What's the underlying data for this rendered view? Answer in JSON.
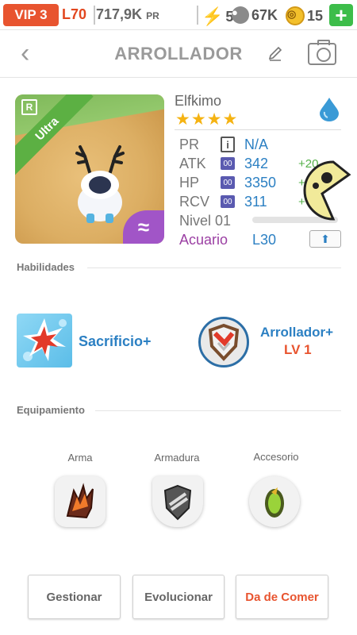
{
  "status_bar": {
    "vip": "VIP 3",
    "level": "L70",
    "power_value": "717,9K",
    "power_unit": "PR",
    "energy": "5",
    "food": "67K",
    "coins": "15",
    "add_label": "+"
  },
  "header": {
    "back_glyph": "‹",
    "title": "ARROLLADOR"
  },
  "monster": {
    "name": "Elfkimo",
    "stars": "★★★★",
    "rarity_letter": "R",
    "rarity_ribbon": "Ultra",
    "element_glyph": "≈",
    "stats": [
      {
        "label": "PR",
        "icon": "i",
        "value": "N/A",
        "bonus": ""
      },
      {
        "label": "ATK",
        "icon": "00",
        "value": "342",
        "bonus": "+20"
      },
      {
        "label": "HP",
        "icon": "00",
        "value": "3350",
        "bonus": "+"
      },
      {
        "label": "RCV",
        "icon": "00",
        "value": "311",
        "bonus": "+"
      }
    ],
    "level_label": "Nivel 01",
    "class_name": "Acuario",
    "class_level": "L30",
    "upgrade_glyph": "⬆"
  },
  "skills": {
    "section_title": "Habilidades",
    "active_name": "Sacrificio+",
    "passive_name": "Arrollador+",
    "passive_level": "LV 1"
  },
  "equipment": {
    "section_title": "Equipamiento",
    "slots": [
      {
        "label": "Arma"
      },
      {
        "label": "Armadura"
      },
      {
        "label": "Accesorio"
      }
    ]
  },
  "actions": {
    "manage": "Gestionar",
    "evolve": "Evolucionar",
    "feed": "Da de Comer"
  },
  "colors": {
    "accent_blue": "#2c80c3",
    "accent_orange": "#e8542f",
    "green": "#3dbd4a",
    "purple": "#9b3fa3"
  }
}
